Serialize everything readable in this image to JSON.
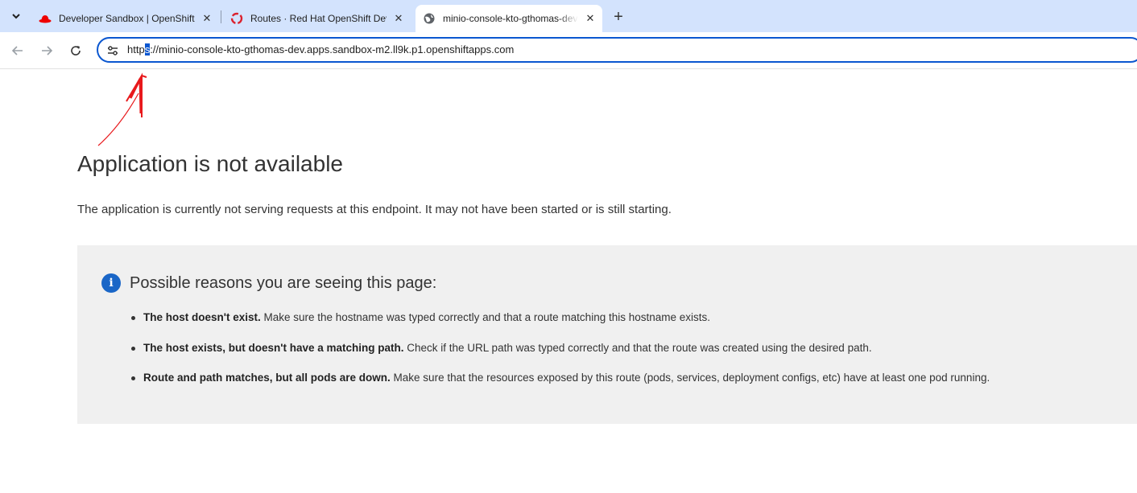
{
  "browser": {
    "tabs": [
      {
        "title": "Developer Sandbox | OpenShift",
        "favicon": "redhat-hat-icon",
        "close": "✕"
      },
      {
        "title": "Routes · Red Hat OpenShift Dev",
        "favicon": "openshift-icon",
        "close": "✕"
      },
      {
        "title": "minio-console-kto-gthomas-dev",
        "favicon": "globe-icon",
        "close": "✕",
        "active": true
      }
    ],
    "new_tab": "+",
    "url_selected": "s",
    "url_before": "http",
    "url_after": "://minio-console-kto-gthomas-dev.apps.sandbox-m2.ll9k.p1.openshiftapps.com",
    "accent": "#0b57d0",
    "tabstrip_color": "#d3e3fd"
  },
  "page": {
    "title": "Application is not available",
    "lead": "The application is currently not serving requests at this endpoint. It may not have been started or is still starting.",
    "reasons": {
      "icon": "i",
      "heading": "Possible reasons you are seeing this page:",
      "items": [
        {
          "bold": "The host doesn't exist.",
          "text": " Make sure the hostname was typed correctly and that a route matching this hostname exists."
        },
        {
          "bold": "The host exists, but doesn't have a matching path.",
          "text": " Check if the URL path was typed correctly and that the route was created using the desired path."
        },
        {
          "bold": "Route and path matches, but all pods are down.",
          "text": " Make sure that the resources exposed by this route (pods, services, deployment configs, etc) have at least one pod running."
        }
      ]
    }
  }
}
